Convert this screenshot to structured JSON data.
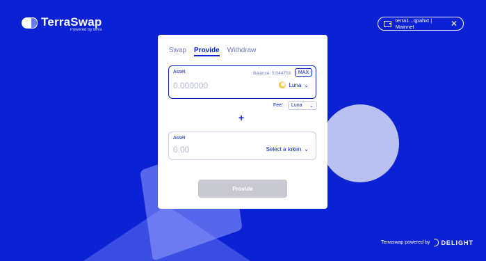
{
  "brand": {
    "title": "TerraSwap",
    "subtitle": "Powered by terra"
  },
  "wallet": {
    "address": "terra1...qpahxt | Mainnet",
    "close_label": "✕"
  },
  "tabs": [
    {
      "label": "Swap",
      "active": false
    },
    {
      "label": "Provide",
      "active": true
    },
    {
      "label": "Withdraw",
      "active": false
    }
  ],
  "asset1": {
    "label": "Asset",
    "balance": "Balance: 5.044703",
    "max_label": "MAX",
    "amount_placeholder": "0.000000",
    "token": "Luna"
  },
  "fee": {
    "label": "Fee:",
    "token": "Luna"
  },
  "plus_symbol": "+",
  "asset2": {
    "label": "Asset",
    "amount_placeholder": "0.00",
    "token": "Select a token"
  },
  "submit_label": "Provide",
  "footer": {
    "powered_by": "Terraswap powered by",
    "company": "DELIGHT"
  },
  "colors": {
    "background": "#0b22d4",
    "accent": "#0b22d4",
    "button_disabled": "#c8c9d1"
  }
}
